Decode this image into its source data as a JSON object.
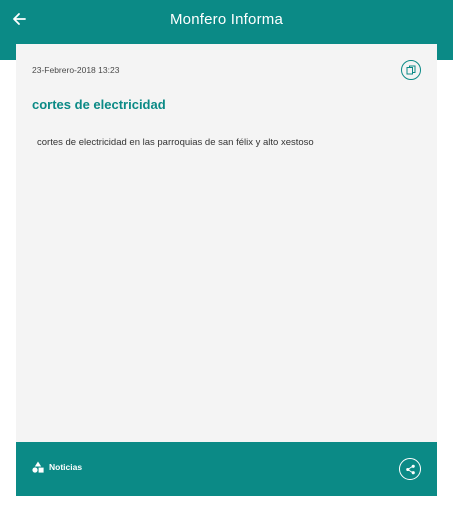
{
  "appbar": {
    "title": "Monfero Informa",
    "back_icon": "arrow-left-icon"
  },
  "article": {
    "date": "23-Febrero-2018 13:23",
    "title": "cortes de electricidad",
    "body": "cortes de electricidad en las parroquias de san félix y alto xestoso",
    "copy_icon": "copy-icon"
  },
  "footer": {
    "section_icon": "shapes-icon",
    "section_label": "Noticias",
    "share_icon": "share-icon"
  },
  "colors": {
    "primary": "#0b8a86",
    "card_background": "#f4f4f4"
  }
}
